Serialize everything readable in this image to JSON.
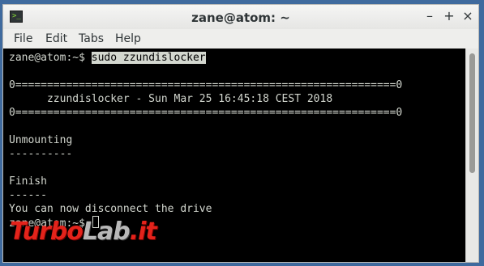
{
  "window": {
    "title": "zane@atom: ~",
    "icon": "terminal-app-icon",
    "controls": {
      "minimize": "–",
      "maximize": "+",
      "close": "×"
    }
  },
  "menu": {
    "items": [
      "File",
      "Edit",
      "Tabs",
      "Help"
    ]
  },
  "terminal": {
    "prompt": "zane@atom:~$ ",
    "command": "sudo zzundislocker",
    "separator": "0============================================================0",
    "banner": "      zzundislocker - Sun Mar 25 16:45:18 CEST 2018",
    "unmounting": "Unmounting",
    "unmounting_rule": "----------",
    "finish": "Finish",
    "finish_rule": "------",
    "message": "You can now disconnect the drive",
    "final_prompt": "zane@atom:~$ "
  },
  "colors": {
    "terminal_bg": "#000000",
    "terminal_fg": "#d3d7cf",
    "desktop_bg": "#3f6a9e"
  },
  "watermark": {
    "part1": "Turbo",
    "part2": "Lab",
    "part3": ".it"
  }
}
